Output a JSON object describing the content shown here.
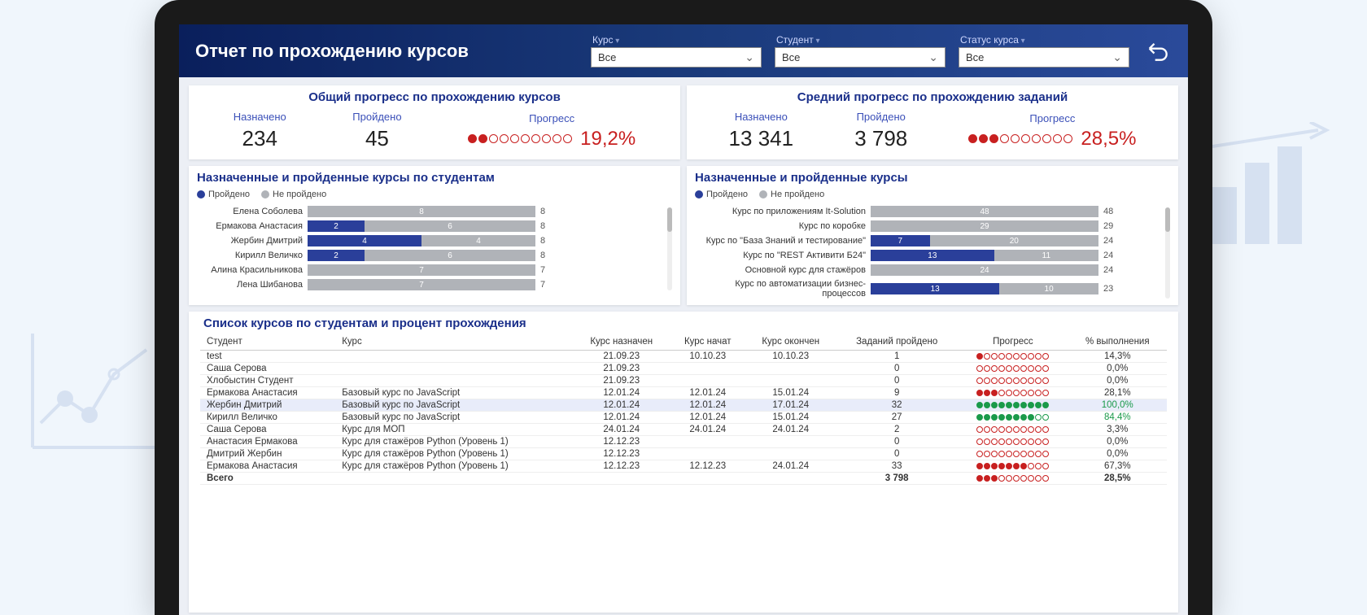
{
  "header": {
    "title": "Отчет по прохождению курсов",
    "filters": [
      {
        "label": "Курс",
        "value": "Все"
      },
      {
        "label": "Студент",
        "value": "Все"
      },
      {
        "label": "Статус курса",
        "value": "Все"
      }
    ]
  },
  "summary": [
    {
      "title": "Общий прогресс по прохождению курсов",
      "assigned_label": "Назначено",
      "assigned": "234",
      "passed_label": "Пройдено",
      "passed": "45",
      "progress_label": "Прогресс",
      "progress_pct": "19,2%",
      "filled": 2
    },
    {
      "title": "Средний прогресс по прохождению заданий",
      "assigned_label": "Назначено",
      "assigned": "13 341",
      "passed_label": "Пройдено",
      "passed": "3 798",
      "progress_label": "Прогресс",
      "progress_pct": "28,5%",
      "filled": 3
    }
  ],
  "chart_data": [
    {
      "type": "bar",
      "title": "Назначенные и пройденные курсы по студентам",
      "legend": [
        "Пройдено",
        "Не пройдено"
      ],
      "categories": [
        "Елена Соболева",
        "Ермакова Анастасия",
        "Жербин Дмитрий",
        "Кирилл Величко",
        "Алина Красильникова",
        "Лена Шибанова"
      ],
      "series": [
        {
          "name": "Пройдено",
          "values": [
            0,
            2,
            4,
            2,
            0,
            0
          ]
        },
        {
          "name": "Не пройдено",
          "values": [
            8,
            6,
            4,
            6,
            7,
            7
          ]
        }
      ],
      "totals": [
        8,
        8,
        8,
        8,
        7,
        7
      ]
    },
    {
      "type": "bar",
      "title": "Назначенные и пройденные курсы",
      "legend": [
        "Пройдено",
        "Не пройдено"
      ],
      "categories": [
        "Курс по приложениям It-Solution",
        "Курс по коробке",
        "Курс по \"База Знаний и тестирование\"",
        "Курс по \"REST Активити Б24\"",
        "Основной курс для стажёров",
        "Курс по автоматизации бизнес-процессов"
      ],
      "series": [
        {
          "name": "Пройдено",
          "values": [
            0,
            0,
            7,
            13,
            0,
            13
          ]
        },
        {
          "name": "Не пройдено",
          "values": [
            48,
            29,
            20,
            11,
            24,
            10
          ]
        }
      ],
      "totals": [
        48,
        29,
        24,
        24,
        24,
        23
      ]
    }
  ],
  "table": {
    "title": "Список курсов по студентам и процент прохождения",
    "columns": [
      "Студент",
      "Курс",
      "Курс назначен",
      "Курс начат",
      "Курс окончен",
      "Заданий пройдено",
      "Прогресс",
      "% выполнения"
    ],
    "rows": [
      {
        "s": "test",
        "c": "",
        "d1": "21.09.23",
        "d2": "10.10.23",
        "d3": "10.10.23",
        "n": "1",
        "f": 1,
        "g": false,
        "p": "14,3%"
      },
      {
        "s": "Саша Серова",
        "c": "",
        "d1": "21.09.23",
        "d2": "",
        "d3": "",
        "n": "0",
        "f": 0,
        "g": false,
        "p": "0,0%"
      },
      {
        "s": "Хлобыстин Студент",
        "c": "",
        "d1": "21.09.23",
        "d2": "",
        "d3": "",
        "n": "0",
        "f": 0,
        "g": false,
        "p": "0,0%"
      },
      {
        "s": "Ермакова Анастасия",
        "c": "Базовый курс по JavaScript",
        "d1": "12.01.24",
        "d2": "12.01.24",
        "d3": "15.01.24",
        "n": "9",
        "f": 3,
        "g": false,
        "p": "28,1%"
      },
      {
        "s": "Жербин Дмитрий",
        "c": "Базовый курс по JavaScript",
        "d1": "12.01.24",
        "d2": "12.01.24",
        "d3": "17.01.24",
        "n": "32",
        "f": 10,
        "g": true,
        "p": "100,0%",
        "hl": true
      },
      {
        "s": "Кирилл Величко",
        "c": "Базовый курс по JavaScript",
        "d1": "12.01.24",
        "d2": "12.01.24",
        "d3": "15.01.24",
        "n": "27",
        "f": 8,
        "g": true,
        "p": "84,4%"
      },
      {
        "s": "Саша Серова",
        "c": "Курс для МОП",
        "d1": "24.01.24",
        "d2": "24.01.24",
        "d3": "24.01.24",
        "n": "2",
        "f": 0,
        "g": false,
        "p": "3,3%"
      },
      {
        "s": "Анастасия Ермакова",
        "c": "Курс для стажёров Python (Уровень 1)",
        "d1": "12.12.23",
        "d2": "",
        "d3": "",
        "n": "0",
        "f": 0,
        "g": false,
        "p": "0,0%"
      },
      {
        "s": "Дмитрий Жербин",
        "c": "Курс для стажёров Python (Уровень 1)",
        "d1": "12.12.23",
        "d2": "",
        "d3": "",
        "n": "0",
        "f": 0,
        "g": false,
        "p": "0,0%"
      },
      {
        "s": "Ермакова Анастасия",
        "c": "Курс для стажёров Python (Уровень 1)",
        "d1": "12.12.23",
        "d2": "12.12.23",
        "d3": "24.01.24",
        "n": "33",
        "f": 7,
        "g": false,
        "p": "67,3%"
      }
    ],
    "total": {
      "label": "Всего",
      "n": "3 798",
      "f": 3,
      "p": "28,5%"
    }
  }
}
